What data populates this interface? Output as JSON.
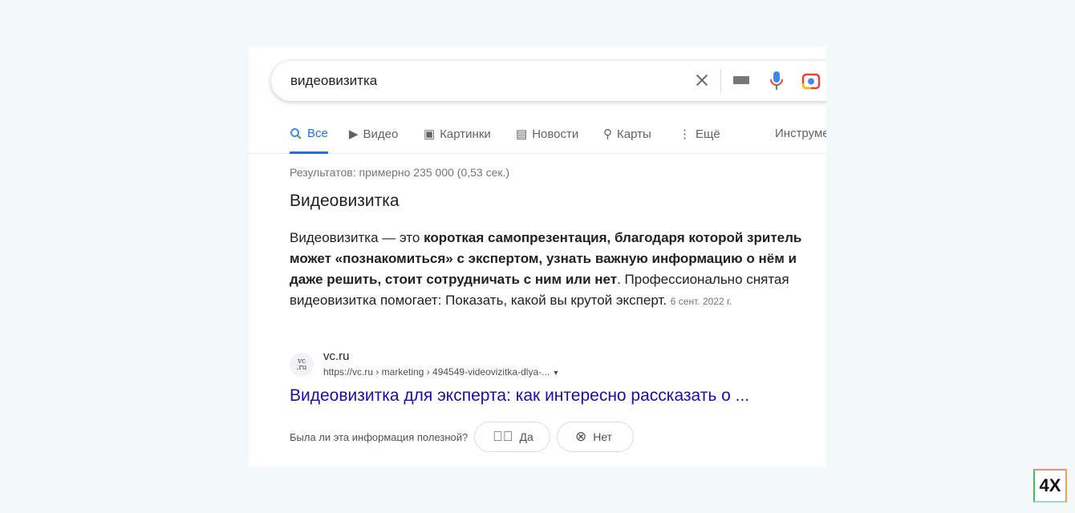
{
  "search": {
    "query": "видеовизитка"
  },
  "tabs": [
    {
      "label": "Все"
    },
    {
      "label": "Видео"
    },
    {
      "label": "Картинки"
    },
    {
      "label": "Новости"
    },
    {
      "label": "Карты"
    },
    {
      "label": "Ещё"
    },
    {
      "label": "Инструменты"
    }
  ],
  "stats": "Результатов: примерно 235 000 (0,53 сек.)",
  "snippet": {
    "heading": "Видеовизитка",
    "intro": "Видеовизитка — это ",
    "bold": "короткая самопрезентация, благодаря которой зритель может «познакомиться» с экспертом, узнать важную информацию о нём и даже решить, стоит сотрудничать с ним или нет",
    "rest": ". Профессионально снятая видеовизитка помогает: Показать, какой вы крутой эксперт.",
    "date": "6 сент. 2022 г."
  },
  "result": {
    "favicon": "vc.ru",
    "site": "vc.ru",
    "url": "https://vc.ru › marketing › 494549-videovizitka-dlya-...",
    "title": "Видеовизитка для эксперта: как интересно рассказать о ..."
  },
  "feedback": {
    "question": "Была ли эта информация полезной?",
    "yes": "Да",
    "no": "Нет"
  },
  "badge": "4X"
}
